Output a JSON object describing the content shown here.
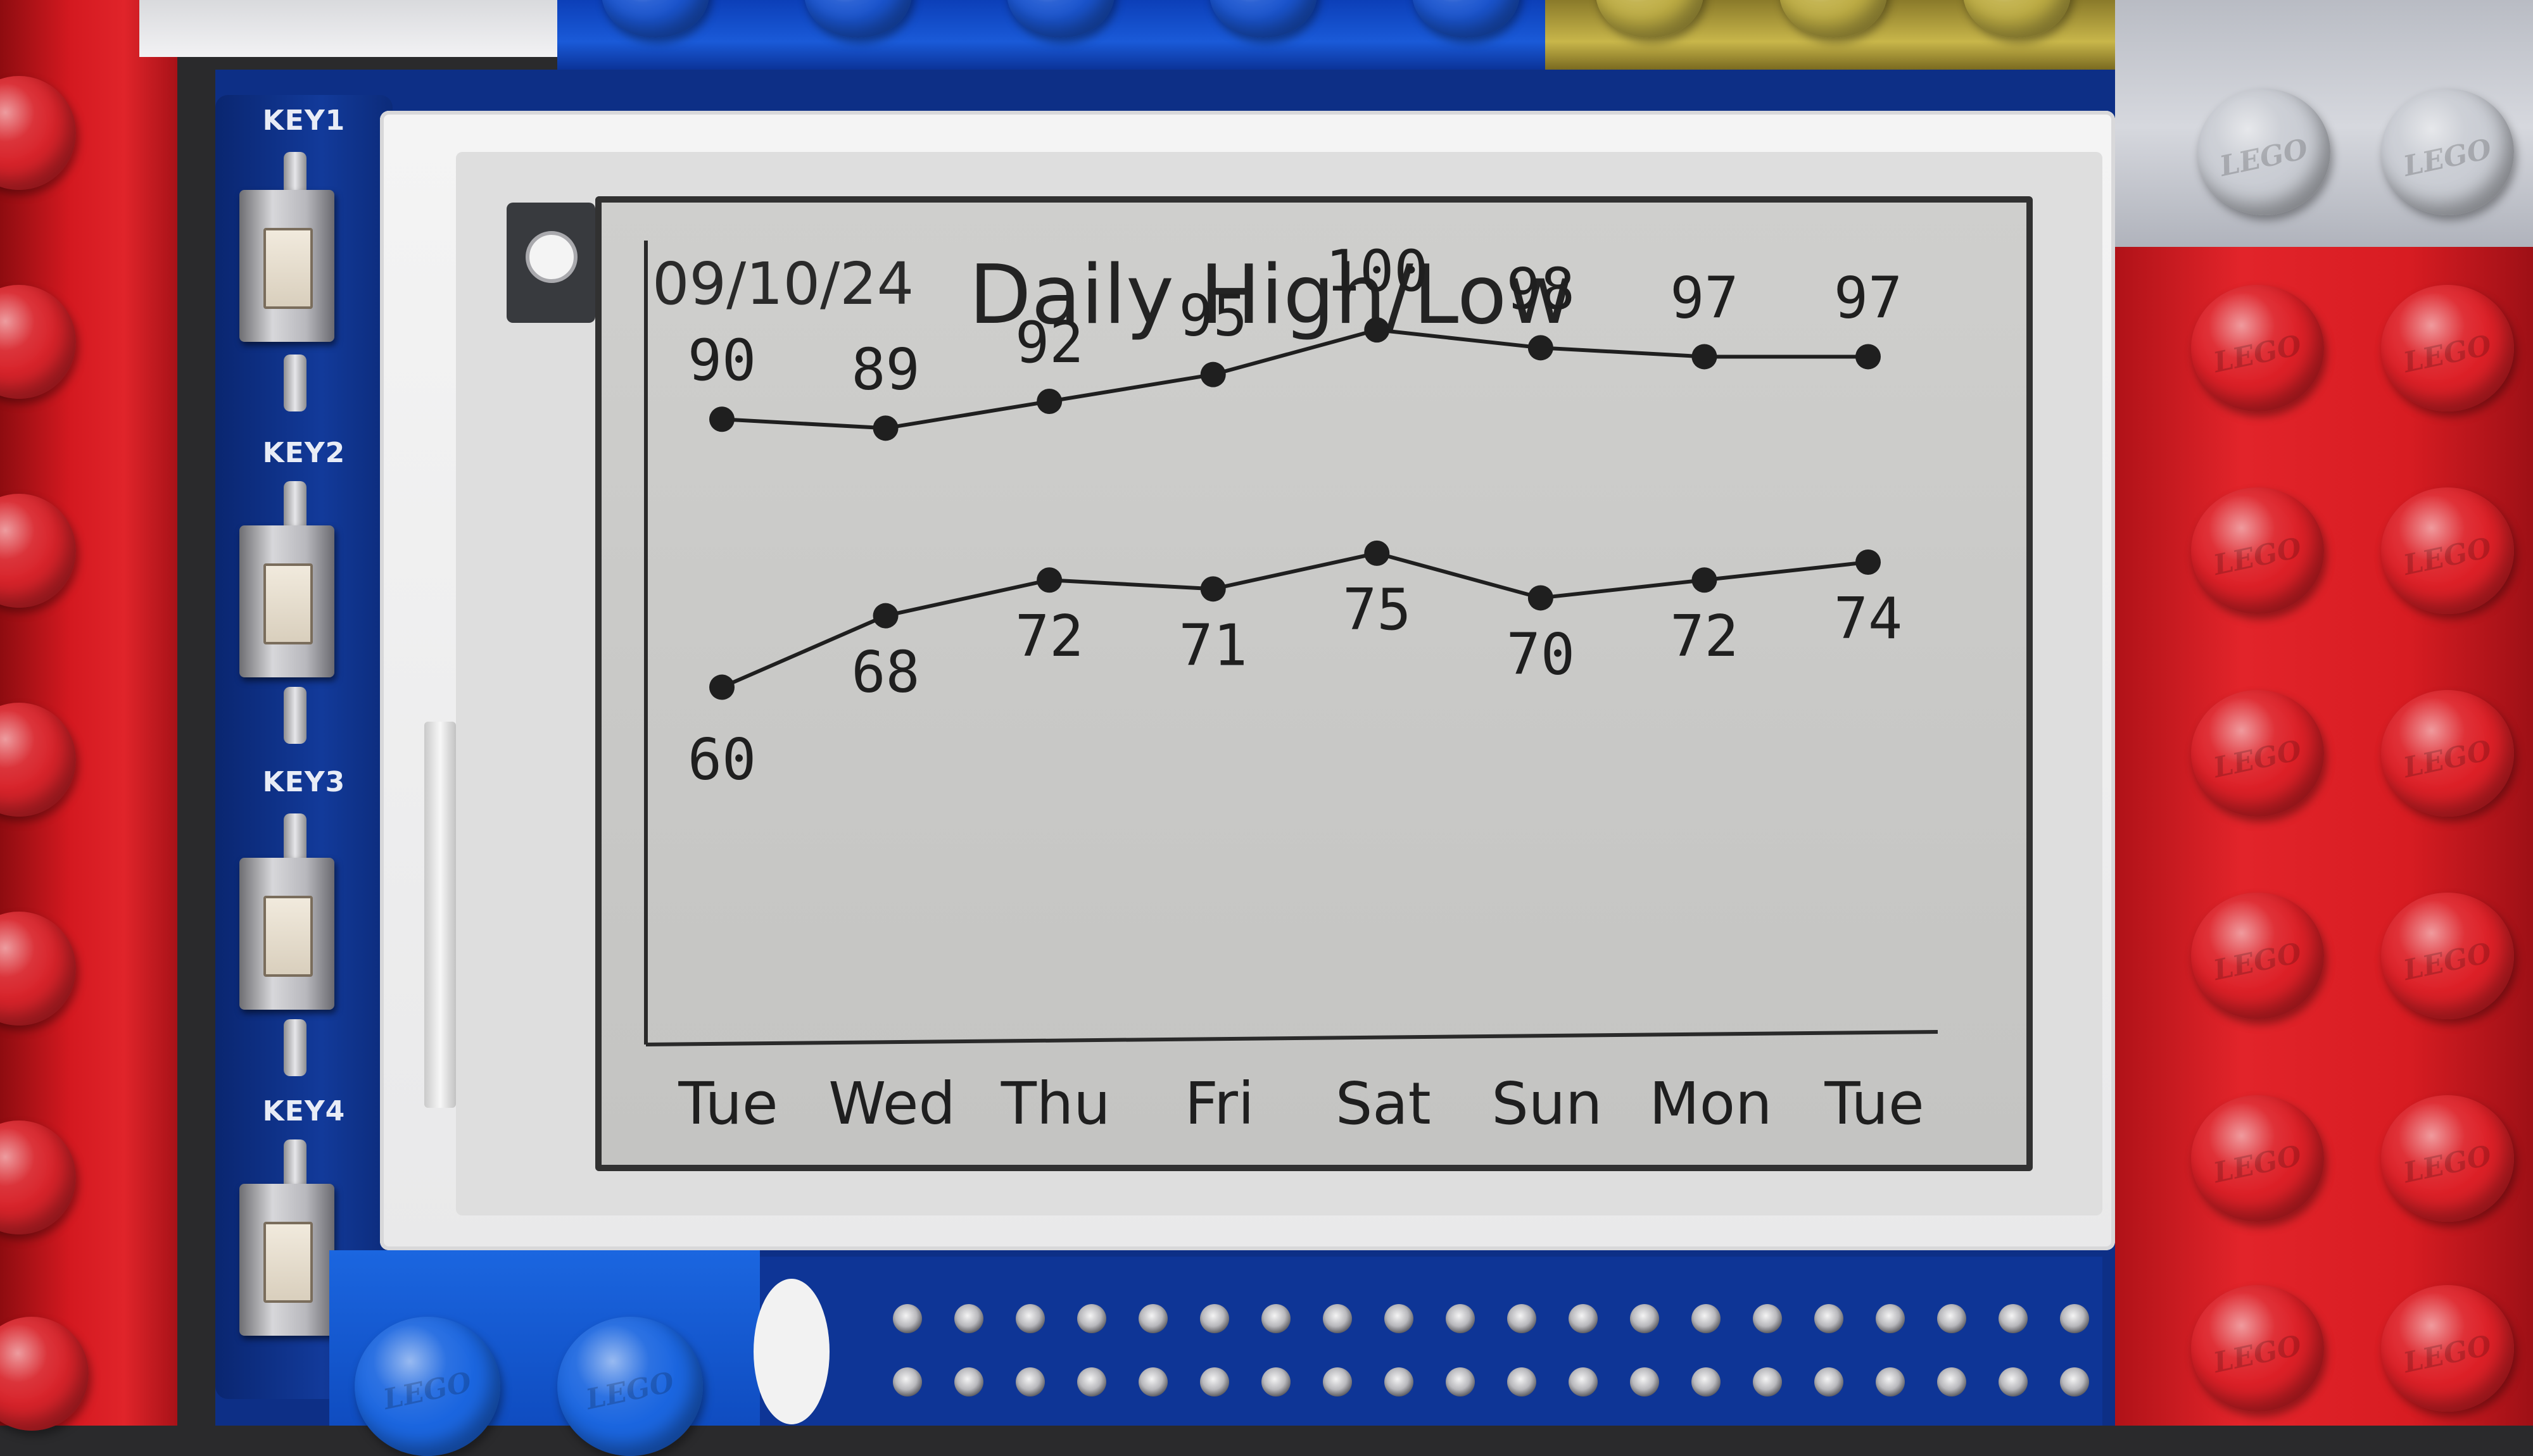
{
  "hardware": {
    "keys": [
      "KEY1",
      "KEY2",
      "KEY3",
      "KEY4"
    ],
    "stud_logo": "LEGO"
  },
  "chart_data": {
    "type": "line",
    "date": "09/10/24",
    "title": "Daily High/Low",
    "categories": [
      "Tue",
      "Wed",
      "Thu",
      "Fri",
      "Sat",
      "Sun",
      "Mon",
      "Tue"
    ],
    "series": [
      {
        "values": [
          90,
          89,
          92,
          95,
          100,
          98,
          97,
          97
        ]
      },
      {
        "values": [
          60,
          68,
          72,
          71,
          75,
          70,
          72,
          74
        ]
      }
    ],
    "ylim": [
      20,
      110
    ],
    "grid": false,
    "legend": "none",
    "colors": {
      "ink": "#1f1f1f",
      "paper": "#cbcbc9"
    }
  }
}
